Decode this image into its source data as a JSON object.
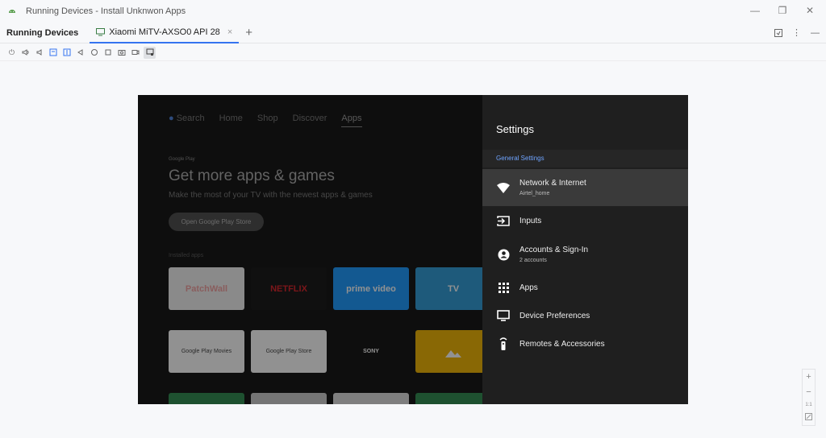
{
  "window": {
    "title": "Running Devices - Install Unknwon Apps",
    "minimize_icon": "minimize-icon",
    "restore_icon": "restore-icon",
    "close_icon": "close-icon"
  },
  "tabbar": {
    "section_title": "Running Devices",
    "device_tab": "Xiaomi MiTV-AXSO0 API 28"
  },
  "tv": {
    "nav": [
      "Search",
      "Home",
      "Shop",
      "Discover",
      "Apps"
    ],
    "google_play_label": "Google Play",
    "heading": "Get more apps & games",
    "subheading": "Make the most of your TV with the newest apps & games",
    "button": "Open Google Play Store",
    "installed_label": "Installed apps",
    "tiles": [
      {
        "label": "PatchWall",
        "bg": "#f2f2f2",
        "fg": "#f0a0a0"
      },
      {
        "label": "NETFLIX",
        "bg": "#141414",
        "fg": "#d81f26"
      },
      {
        "label": "prime video",
        "bg": "#1a98ff",
        "fg": "#ffffff"
      },
      {
        "label": "TV",
        "bg": "#2e9bd6",
        "fg": "#ffffff"
      },
      {
        "label": "Google Play Movies",
        "bg": "#ffffff",
        "fg": "#444444"
      },
      {
        "label": "Google Play Store",
        "bg": "#ffffff",
        "fg": "#444444"
      },
      {
        "label": "SONY",
        "bg": "#111111",
        "fg": "#ffffff"
      }
    ]
  },
  "settings": {
    "title": "Settings",
    "section": "General Settings",
    "items": [
      {
        "label": "Network & Internet",
        "sub": "Airtel_home",
        "icon": "wifi-icon"
      },
      {
        "label": "Inputs",
        "sub": "",
        "icon": "input-icon"
      },
      {
        "label": "Accounts & Sign-In",
        "sub": "2 accounts",
        "icon": "account-icon"
      },
      {
        "label": "Apps",
        "sub": "",
        "icon": "apps-grid-icon"
      },
      {
        "label": "Device Preferences",
        "sub": "",
        "icon": "tv-icon"
      },
      {
        "label": "Remotes & Accessories",
        "sub": "",
        "icon": "remote-icon"
      }
    ]
  },
  "zoom": {
    "zoom_in": "+",
    "zoom_out": "−",
    "actual_size": "1:1"
  }
}
